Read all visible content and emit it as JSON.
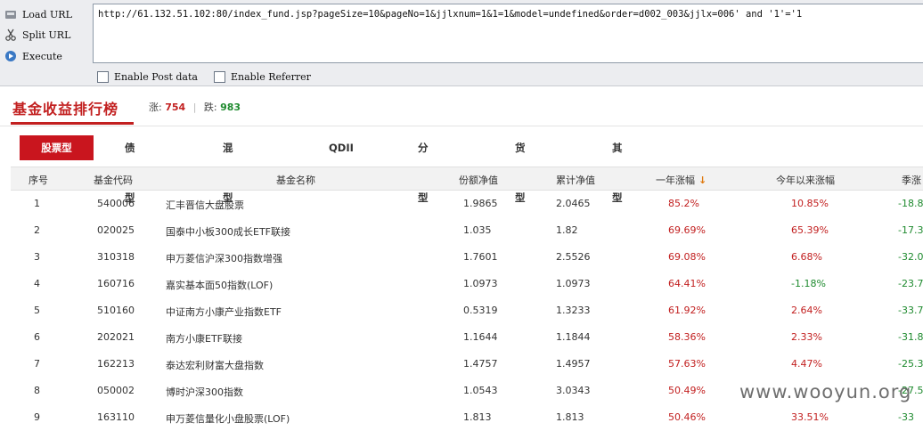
{
  "hackbar": {
    "load_label": "Load URL",
    "split_label": "Split URL",
    "execute_label": "Execute",
    "url_value": "http://61.132.51.102:80/index_fund.jsp?pageSize=10&pageNo=1&jjlxnum=1&1=1&model=undefined&order=d002_003&jjlx=006' and '1'='1",
    "post_label": "Enable Post data",
    "referrer_label": "Enable Referrer"
  },
  "page": {
    "title": "基金收益排行榜",
    "up_label": "涨:",
    "up_count": "754",
    "down_label": "跌:",
    "down_count": "983"
  },
  "tabs": [
    "股票型",
    "债券型",
    "混合型",
    "QDII",
    "分级型",
    "货币型",
    "其他型"
  ],
  "table": {
    "headers": [
      "序号",
      "基金代码",
      "基金名称",
      "份额净值",
      "累计净值",
      "一年涨幅",
      "今年以来涨幅",
      "季涨"
    ],
    "rows": [
      [
        "1",
        "540006",
        "汇丰晋信大盘股票",
        "1.9865",
        "2.0465",
        "85.2%",
        "10.85%",
        "-18.8"
      ],
      [
        "2",
        "020025",
        "国泰中小板300成长ETF联接",
        "1.035",
        "1.82",
        "69.69%",
        "65.39%",
        "-17.3"
      ],
      [
        "3",
        "310318",
        "申万菱信沪深300指数增强",
        "1.7601",
        "2.5526",
        "69.08%",
        "6.68%",
        "-32.0"
      ],
      [
        "4",
        "160716",
        "嘉实基本面50指数(LOF)",
        "1.0973",
        "1.0973",
        "64.41%",
        "-1.18%",
        "-23.7"
      ],
      [
        "5",
        "510160",
        "中证南方小康产业指数ETF",
        "0.5319",
        "1.3233",
        "61.92%",
        "2.64%",
        "-33.7"
      ],
      [
        "6",
        "202021",
        "南方小康ETF联接",
        "1.1644",
        "1.1844",
        "58.36%",
        "2.33%",
        "-31.8"
      ],
      [
        "7",
        "162213",
        "泰达宏利财富大盘指数",
        "1.4757",
        "1.4957",
        "57.63%",
        "4.47%",
        "-25.3"
      ],
      [
        "8",
        "050002",
        "博时沪深300指数",
        "1.0543",
        "3.0343",
        "50.49%",
        "",
        "-27.5"
      ],
      [
        "9",
        "163110",
        "申万菱信量化小盘股票(LOF)",
        "1.813",
        "1.813",
        "50.46%",
        "33.51%",
        "-33"
      ]
    ]
  },
  "watermark": "www.wooyun.org",
  "colors": {
    "accent_red": "#c22020",
    "tab_red": "#c9151e",
    "green": "#1e8a2e"
  }
}
